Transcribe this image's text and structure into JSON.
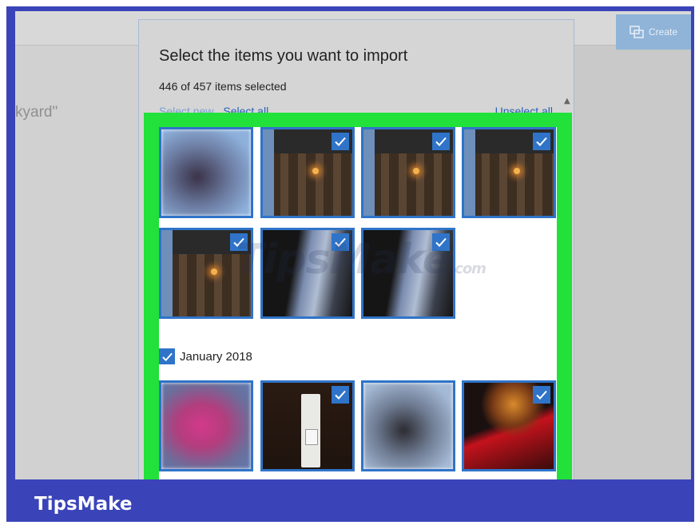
{
  "background": {
    "left_text": "kyard\"",
    "create_button_label": "Create"
  },
  "dialog": {
    "title": "Select the items you want to import",
    "count_text": "446 of 457 items selected",
    "select_new_label": "Select new",
    "select_all_label": "Select all",
    "unselect_all_label": "Unselect all"
  },
  "grid": {
    "section_label": "January 2018",
    "section_checked": true,
    "photos": [
      {
        "name": "photo-1",
        "checked": false
      },
      {
        "name": "photo-2",
        "checked": true
      },
      {
        "name": "photo-3",
        "checked": true
      },
      {
        "name": "photo-4",
        "checked": true
      },
      {
        "name": "photo-5",
        "checked": true
      },
      {
        "name": "photo-6",
        "checked": true
      },
      {
        "name": "photo-7",
        "checked": true
      },
      {
        "name": "photo-8",
        "checked": false
      },
      {
        "name": "photo-9",
        "checked": true
      },
      {
        "name": "photo-10",
        "checked": false
      },
      {
        "name": "photo-11",
        "checked": true
      }
    ]
  },
  "watermark": {
    "text": "TipsMake",
    "suffix": ".com"
  },
  "footer": {
    "brand": "TipsMake"
  },
  "colors": {
    "highlight": "#22e13a",
    "accent": "#2f74c9",
    "frame": "#3a44b8"
  }
}
